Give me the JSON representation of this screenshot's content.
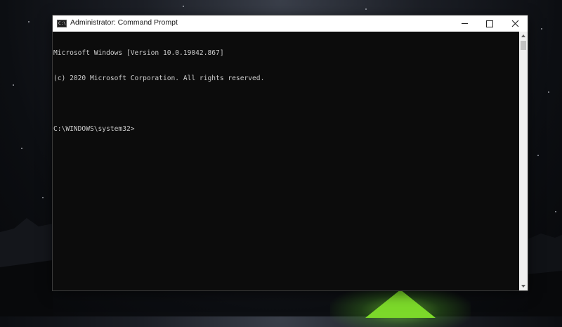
{
  "window": {
    "title": "Administrator: Command Prompt",
    "icon": "cmd-app-icon"
  },
  "controls": {
    "minimize": "minimize-icon",
    "maximize": "maximize-icon",
    "close": "close-icon"
  },
  "console": {
    "lines": [
      "Microsoft Windows [Version 10.0.19042.867]",
      "(c) 2020 Microsoft Corporation. All rights reserved.",
      "",
      "C:\\WINDOWS\\system32>"
    ]
  },
  "colors": {
    "console_bg": "#0c0c0c",
    "console_text": "#cccccc",
    "titlebar_bg": "#ffffff"
  }
}
